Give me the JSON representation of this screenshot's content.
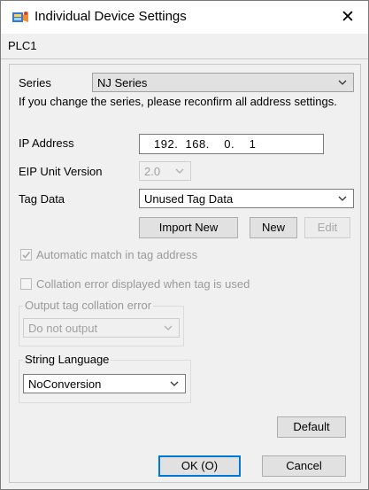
{
  "window": {
    "title": "Individual Device Settings",
    "close_glyph": "✕"
  },
  "device": {
    "name": "PLC1"
  },
  "series": {
    "label": "Series",
    "value": "NJ Series",
    "note": "If you change the series, please reconfirm all address settings."
  },
  "ip": {
    "label": "IP Address",
    "value": "192.  168.    0.    1"
  },
  "eip": {
    "label": "EIP Unit Version",
    "value": "2.0"
  },
  "tag": {
    "label": "Tag Data",
    "value": "Unused Tag Data",
    "import_new": "Import New",
    "new": "New",
    "edit": "Edit"
  },
  "auto_match": {
    "label": "Automatic match in tag address",
    "checked": true
  },
  "collation_display": {
    "label": "Collation error displayed when tag is used",
    "checked": false
  },
  "output_collation": {
    "label": "Output tag collation error",
    "value": "Do not output"
  },
  "string_language": {
    "label": "String Language",
    "value": "NoConversion"
  },
  "buttons": {
    "default": "Default",
    "ok": "OK (O)",
    "cancel": "Cancel"
  },
  "icons": {
    "app": "plc-device-icon",
    "chevron": "chevron-down-icon",
    "check": "checkmark-icon"
  }
}
